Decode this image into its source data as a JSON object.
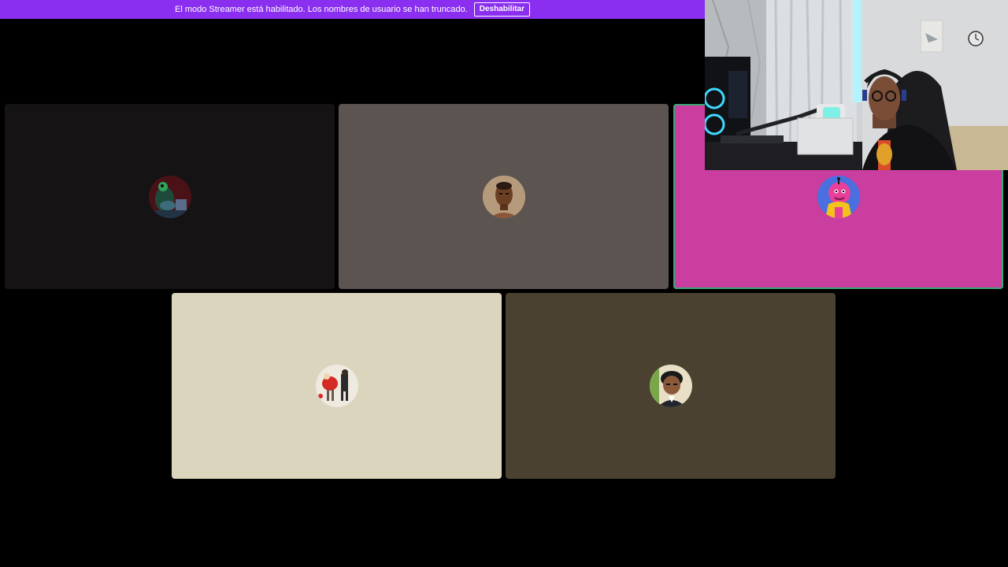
{
  "notice": {
    "text": "El modo Streamer está habilitado. Los nombres de usuario se han truncado.",
    "button_label": "Deshabilitar",
    "bar_color": "#8a2ef0"
  },
  "tiles": [
    {
      "color": "#151314",
      "avatar_icon": "frog-avatar-icon",
      "speaking": false
    },
    {
      "color": "#5c5450",
      "avatar_icon": "man-portrait-avatar-icon",
      "speaking": false
    },
    {
      "color": "#c93e9e",
      "avatar_icon": "pink-cartoon-avatar-icon",
      "speaking": true
    },
    {
      "color": "#dbd5bd",
      "avatar_icon": "cartoon-duo-avatar-icon",
      "speaking": false
    },
    {
      "color": "#4a4130",
      "avatar_icon": "anime-boy-avatar-icon",
      "speaking": false
    }
  ],
  "speaking_ring_color": "#3aa877"
}
